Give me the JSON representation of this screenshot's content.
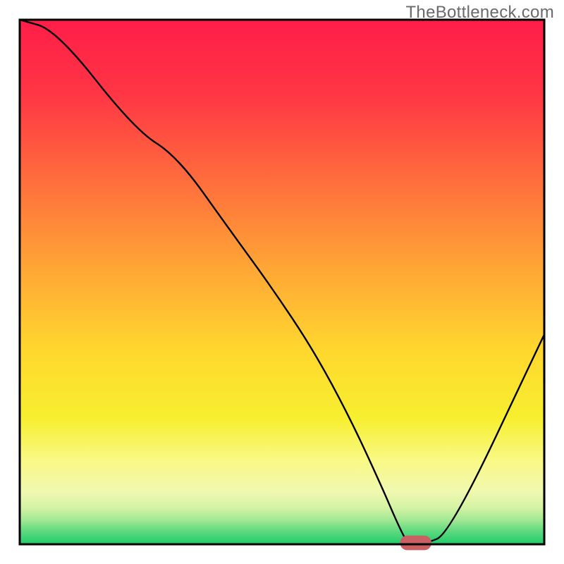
{
  "watermark": "TheBottleneck.com",
  "chart_data": {
    "type": "line",
    "title": "",
    "xlabel": "",
    "ylabel": "",
    "xlim": [
      0,
      100
    ],
    "ylim": [
      0,
      100
    ],
    "x": [
      0,
      7,
      22,
      30,
      40,
      48,
      56,
      63,
      69,
      72,
      74,
      77,
      82,
      100
    ],
    "values": [
      100,
      98,
      79,
      74,
      60,
      49,
      37,
      24,
      11,
      4,
      0,
      0,
      2,
      40
    ],
    "marker": {
      "cx": 75.5,
      "cy": 0,
      "w": 6,
      "h": 2.8,
      "color": "#c96064"
    },
    "gradient_stops": [
      {
        "offset": 0,
        "color": "#ff1e48"
      },
      {
        "offset": 0.14,
        "color": "#ff3545"
      },
      {
        "offset": 0.3,
        "color": "#ff6b3d"
      },
      {
        "offset": 0.48,
        "color": "#ffa835"
      },
      {
        "offset": 0.63,
        "color": "#ffd72e"
      },
      {
        "offset": 0.76,
        "color": "#f7ef2f"
      },
      {
        "offset": 0.84,
        "color": "#f9f985"
      },
      {
        "offset": 0.9,
        "color": "#f1f8b0"
      },
      {
        "offset": 0.93,
        "color": "#d4f3a4"
      },
      {
        "offset": 0.955,
        "color": "#9fe792"
      },
      {
        "offset": 0.975,
        "color": "#5ed97f"
      },
      {
        "offset": 1.0,
        "color": "#1fcc6b"
      }
    ],
    "frame": {
      "border_color": "#000000",
      "border_width": 3,
      "inset": 28
    }
  }
}
